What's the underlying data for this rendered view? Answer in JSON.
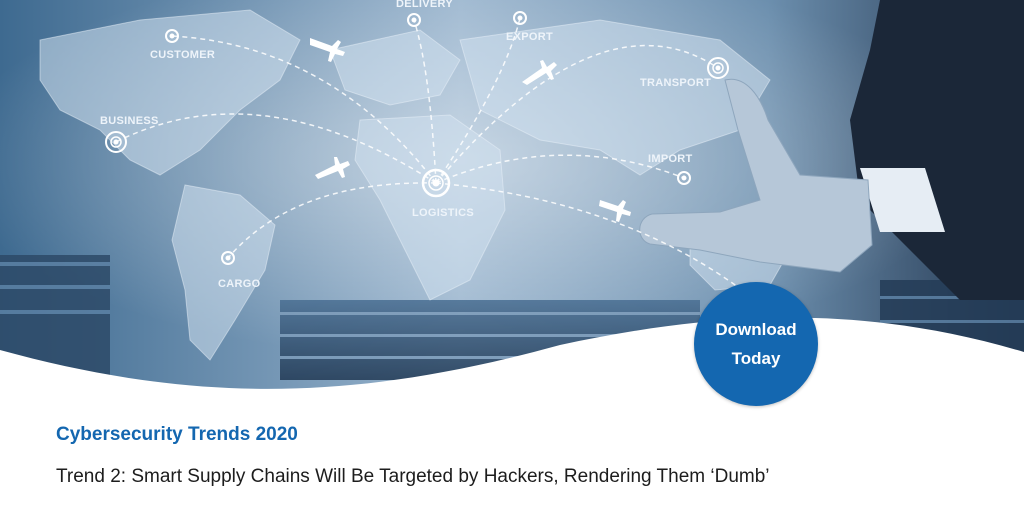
{
  "hero": {
    "map_labels": [
      "DELIVERY",
      "EXPORT",
      "CUSTOMER",
      "TRANSPORT",
      "BUSINESS",
      "IMPORT",
      "LOGISTICS",
      "CARGO"
    ]
  },
  "cta": {
    "line1": "Download",
    "line2": "Today",
    "color": "#1467b0"
  },
  "content": {
    "subtitle": "Cybersecurity Trends 2020",
    "headline": "Trend 2: Smart Supply Chains Will Be Targeted by Hackers, Rendering Them ‘Dumb’"
  },
  "colors": {
    "accent": "#1467b0",
    "text": "#1d1d1d",
    "background": "#ffffff"
  }
}
